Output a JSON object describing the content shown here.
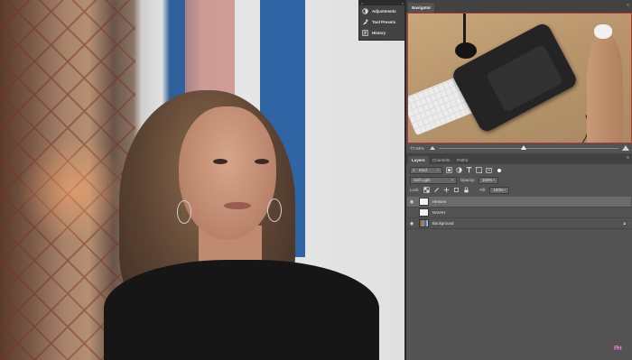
{
  "mini_panel": {
    "items": [
      {
        "icon": "adjustments-icon",
        "label": "Adjustments"
      },
      {
        "icon": "tool-presets-icon",
        "label": "Tool Presets"
      },
      {
        "icon": "history-icon",
        "label": "History"
      }
    ]
  },
  "navigator": {
    "tab_label": "Navigator",
    "zoom_value": "77.04%",
    "zoom_level_fraction": 0.47
  },
  "layers_panel": {
    "tabs": [
      "Layers",
      "Channels",
      "Paths"
    ],
    "filter_kind": "Kind",
    "blend_mode": "Soft Light",
    "opacity_label": "Opacity:",
    "opacity_value": "100%",
    "lock_label": "Lock:",
    "fill_label": "Fill:",
    "fill_value": "100%",
    "layers": [
      {
        "name": "Hensee",
        "selected": true,
        "visible": true,
        "locked": false,
        "thumb": "white"
      },
      {
        "name": "NAVAH",
        "selected": false,
        "visible": false,
        "locked": false,
        "thumb": "white"
      },
      {
        "name": "Background",
        "selected": false,
        "visible": true,
        "locked": true,
        "thumb": "photo"
      }
    ]
  },
  "watermark": "PH",
  "colors": {
    "panel_bg": "#535353",
    "tab_bar": "#424242",
    "selected_layer": "#6b6b6b",
    "navigator_frame": "#bb3333"
  }
}
